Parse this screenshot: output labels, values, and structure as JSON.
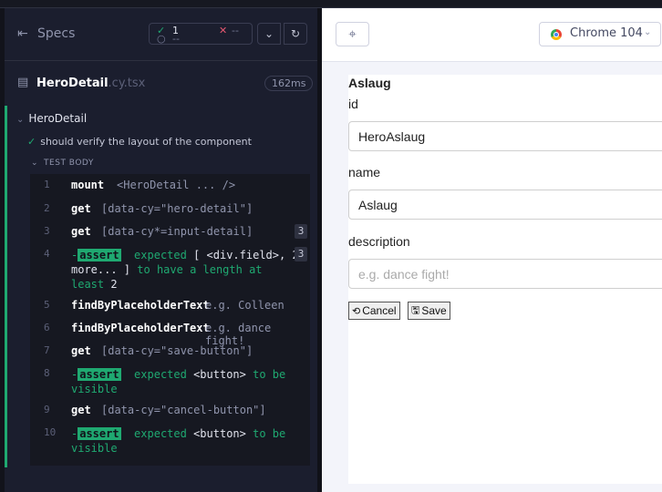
{
  "reporter": {
    "specs_label": "Specs",
    "stats": {
      "passed": "1",
      "failed": "--",
      "pending": "--"
    },
    "file": {
      "name": "HeroDetail",
      "ext": ".cy.tsx",
      "duration": "162ms"
    },
    "suite": "HeroDetail",
    "test": "should verify the layout of the component",
    "body_label": "TEST BODY",
    "commands": [
      {
        "num": "1",
        "name": "mount",
        "message": "<HeroDetail ... />"
      },
      {
        "num": "2",
        "name": "get",
        "message": "[data-cy=\"hero-detail\"]"
      },
      {
        "num": "3",
        "name": "get",
        "message": "[data-cy*=input-detail]",
        "badge": "3"
      },
      {
        "num": "4",
        "assert": "assert",
        "expected": "expected",
        "value": "[ <div.field>, 2 more... ]",
        "rest": "to have a length at least",
        "target": "2",
        "badge": "3"
      },
      {
        "num": "5",
        "name": "findByPlaceholderText",
        "message": "e.g. Colleen"
      },
      {
        "num": "6",
        "name": "findByPlaceholderText",
        "message": "e.g. dance fight!"
      },
      {
        "num": "7",
        "name": "get",
        "message": "[data-cy=\"save-button\"]"
      },
      {
        "num": "8",
        "assert": "assert",
        "expected": "expected",
        "value": "<button>",
        "rest": "to be visible"
      },
      {
        "num": "9",
        "name": "get",
        "message": "[data-cy=\"cancel-button\"]"
      },
      {
        "num": "10",
        "assert": "assert",
        "expected": "expected",
        "value": "<button>",
        "rest": "to be visible"
      }
    ]
  },
  "aut": {
    "browser": "Chrome 104",
    "hero": {
      "title": "Aslaug",
      "fields": [
        {
          "label": "id",
          "value": "HeroAslaug",
          "placeholder": ""
        },
        {
          "label": "name",
          "value": "Aslaug",
          "placeholder": ""
        },
        {
          "label": "description",
          "value": "",
          "placeholder": "e.g. dance fight!"
        }
      ],
      "cancel_label": "Cancel",
      "save_label": "Save"
    }
  },
  "colors": {
    "pass": "#1fa971",
    "fail": "#e45770",
    "bg": "#1b1e2e"
  }
}
